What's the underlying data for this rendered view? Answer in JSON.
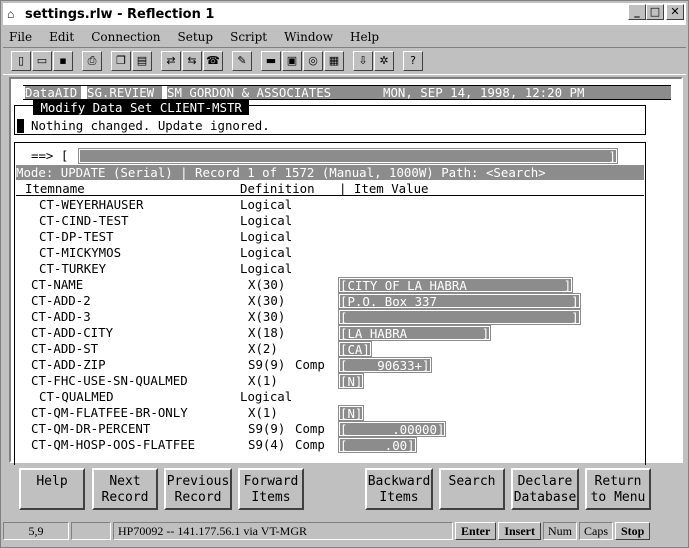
{
  "window": {
    "title": "settings.rlw - Reflection 1",
    "min": "_",
    "max": "□",
    "close": "✕"
  },
  "menu": [
    "File",
    "Edit",
    "Connection",
    "Setup",
    "Script",
    "Window",
    "Help"
  ],
  "terminal": {
    "header": {
      "tab1": "DataAID",
      "tab2": "SG.REVIEW",
      "company": "SM GORDON & ASSOCIATES",
      "datetime": "MON, SEP 14, 1998, 12:20 PM"
    },
    "dialog_title": " Modify Data Set CLIENT-MSTR ",
    "message": "Nothing changed. Update ignored.",
    "prompt": "==> [",
    "prompt_end": "]",
    "mode_line": "Mode: UPDATE (Serial) | Record 1 of 1572 (Manual, 1000W) Path: <Search>",
    "columns": {
      "item": "Itemname",
      "def": "Definition",
      "val": "| Item Value"
    },
    "rows": [
      {
        "name": "CT-WEYERHAUSER",
        "def": "Logical",
        "type": "",
        "value": null
      },
      {
        "name": "CT-CIND-TEST",
        "def": "Logical",
        "type": "",
        "value": null
      },
      {
        "name": "CT-DP-TEST",
        "def": "Logical",
        "type": "",
        "value": null
      },
      {
        "name": "CT-MICKYMOS",
        "def": "Logical",
        "type": "",
        "value": null
      },
      {
        "name": "CT-TURKEY",
        "def": "Logical",
        "type": "",
        "value": null
      },
      {
        "name": "CT-NAME",
        "def": "X(30)",
        "type": "",
        "value": "[CITY OF LA HABRA             ]"
      },
      {
        "name": "CT-ADD-2",
        "def": "X(30)",
        "type": "",
        "value": "[P.O. Box 337                  ]"
      },
      {
        "name": "CT-ADD-3",
        "def": "X(30)",
        "type": "",
        "value": "[                              ]"
      },
      {
        "name": "CT-ADD-CITY",
        "def": "X(18)",
        "type": "",
        "value": "[LA HABRA          ]"
      },
      {
        "name": "CT-ADD-ST",
        "def": "X(2)",
        "type": "",
        "value": "[CA]"
      },
      {
        "name": "CT-ADD-ZIP",
        "def": "S9(9)",
        "type": "Comp",
        "value": "[    90633+]"
      },
      {
        "name": "CT-FHC-USE-SN-QUALMED",
        "def": "X(1)",
        "type": "",
        "value": "[N]"
      },
      {
        "name": "CT-QUALMED",
        "def": "Logical",
        "type": "",
        "value": null
      },
      {
        "name": "CT-QM-FLATFEE-BR-ONLY",
        "def": "X(1)",
        "type": "",
        "value": "[N]"
      },
      {
        "name": "CT-QM-DR-PERCENT",
        "def": "S9(9)",
        "type": "Comp",
        "value": "[      .00000]"
      },
      {
        "name": "CT-QM-HOSP-OOS-FLATFEE",
        "def": "S9(4)",
        "type": "Comp",
        "value": "[     .00]"
      }
    ]
  },
  "fkeys": [
    "Help",
    "Next\nRecord",
    "Previous\nRecord",
    "Forward\nItems",
    "Backward\nItems",
    "Search",
    "Declare\nDatabase",
    "Return\nto Menu"
  ],
  "status": {
    "cursor": "5,9",
    "host": "HP70092 -- 141.177.56.1 via VT-MGR",
    "keys": [
      "Enter",
      "Insert",
      "Num",
      "Caps",
      "Stop"
    ]
  }
}
